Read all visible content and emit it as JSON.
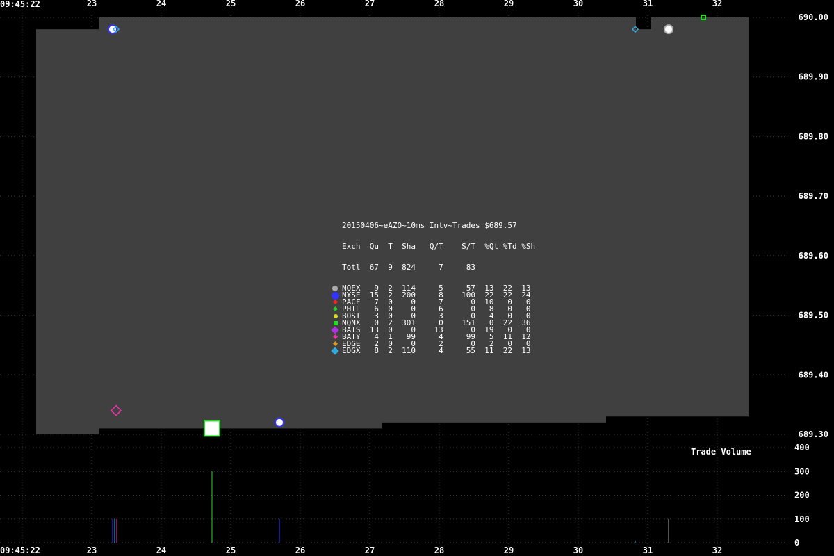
{
  "chart_data": {
    "type": "scatter",
    "start_time": "09:45:22",
    "x_ticks": [
      "23",
      "24",
      "25",
      "26",
      "27",
      "28",
      "29",
      "30",
      "31",
      "32"
    ],
    "price_ticks": [
      "690.00",
      "689.90",
      "689.80",
      "689.70",
      "689.60",
      "689.50",
      "689.40",
      "689.30"
    ],
    "price_ylim": [
      689.3,
      690.0
    ],
    "volume_ticks": [
      "400",
      "300",
      "200",
      "100",
      "0"
    ],
    "volume_ylim": [
      0,
      400
    ],
    "volume_label": "Trade Volume",
    "grid": true,
    "quote_bands": [
      {
        "x0": 22.2,
        "x1": 23.1,
        "bid": 689.3,
        "ask": 689.98
      },
      {
        "x0": 23.1,
        "x1": 24.43,
        "bid": 689.31,
        "ask": 690.0
      },
      {
        "x0": 24.43,
        "x1": 27.18,
        "bid": 689.31,
        "ask": 690.0
      },
      {
        "x0": 27.18,
        "x1": 30.4,
        "bid": 689.32,
        "ask": 690.0
      },
      {
        "x0": 30.4,
        "x1": 30.83,
        "bid": 689.33,
        "ask": 690.0
      },
      {
        "x0": 30.83,
        "x1": 31.05,
        "bid": 689.33,
        "ask": 689.98
      },
      {
        "x0": 31.05,
        "x1": 32.45,
        "bid": 689.33,
        "ask": 690.0
      }
    ],
    "trades": [
      {
        "x": 23.3,
        "price": 689.98,
        "exch": "NYSE"
      },
      {
        "x": 23.35,
        "price": 689.98,
        "exch": "EDGX"
      },
      {
        "x": 23.35,
        "price": 689.34,
        "exch": "BATY"
      },
      {
        "x": 24.73,
        "price": 689.31,
        "exch": "NQNX"
      },
      {
        "x": 25.7,
        "price": 689.32,
        "exch": "NYSE"
      },
      {
        "x": 30.82,
        "price": 689.98,
        "exch": "EDGX"
      },
      {
        "x": 31.3,
        "price": 689.98,
        "exch": "NQEX"
      },
      {
        "x": 31.8,
        "price": 690.0,
        "exch": "NQNX"
      }
    ],
    "volumes": [
      {
        "x": 23.3,
        "v": 100,
        "exch": "NYSE"
      },
      {
        "x": 23.33,
        "v": 100,
        "exch": "EDGX"
      },
      {
        "x": 23.36,
        "v": 100,
        "exch": "BATY"
      },
      {
        "x": 24.73,
        "v": 300,
        "exch": "NQNX"
      },
      {
        "x": 25.7,
        "v": 100,
        "exch": "NYSE"
      },
      {
        "x": 30.82,
        "v": 10,
        "exch": "EDGX"
      },
      {
        "x": 31.3,
        "v": 100,
        "exch": "NQEX"
      }
    ],
    "exch_colors": {
      "NQEX": "#aaaaaa",
      "NYSE": "#3333ff",
      "PACF": "#ff2222",
      "PHIL": "#22cc22",
      "BOST": "#dddd22",
      "NQNX": "#22dd22",
      "BATS": "#aa33dd",
      "BATY": "#ee33aa",
      "EDGE": "#dd9922",
      "EDGX": "#33aadd"
    }
  },
  "legend": {
    "title": "20150406~eAZO~10ms Intv~Trades $689.57",
    "header": "Exch  Qu  T  Sha   Q/T    S/T  %Qt %Td %Sh",
    "total": "Totl  67  9  824     7     83",
    "rows": [
      {
        "exch": "NQEX",
        "text": "NQEX   9  2  114     5     57  13  22  13",
        "marker": "circle",
        "color": "#aaaaaa"
      },
      {
        "exch": "NYSE",
        "text": "NYSE  15  2  200     8    100  22  22  24",
        "marker": "circle-big",
        "color": "#3333ff"
      },
      {
        "exch": "PACF",
        "text": "PACF   7  0    0     7      0  10   0   0",
        "marker": "diamond-small",
        "color": "#ff2222"
      },
      {
        "exch": "PHIL",
        "text": "PHIL   6  0    0     6      0   8   0   0",
        "marker": "diamond-small",
        "color": "#22cc22"
      },
      {
        "exch": "BOST",
        "text": "BOST   3  0    0     3      0   4   0   0",
        "marker": "circle-small",
        "color": "#dddd22"
      },
      {
        "exch": "NQNX",
        "text": "NQNX   0  2  301     0    151   0  22  36",
        "marker": "square",
        "color": "#22dd22"
      },
      {
        "exch": "BATS",
        "text": "BATS  13  0    0    13      0  19   0   0",
        "marker": "diamond",
        "color": "#aa33dd"
      },
      {
        "exch": "BATY",
        "text": "BATY   4  1   99     4     99   5  11  12",
        "marker": "diamond-small",
        "color": "#ee33aa"
      },
      {
        "exch": "EDGE",
        "text": "EDGE   2  0    0     2      0   2   0   0",
        "marker": "diamond-small",
        "color": "#dd9922"
      },
      {
        "exch": "EDGX",
        "text": "EDGX   8  2  110     4     55  11  22  13",
        "marker": "diamond",
        "color": "#33aadd"
      }
    ]
  }
}
